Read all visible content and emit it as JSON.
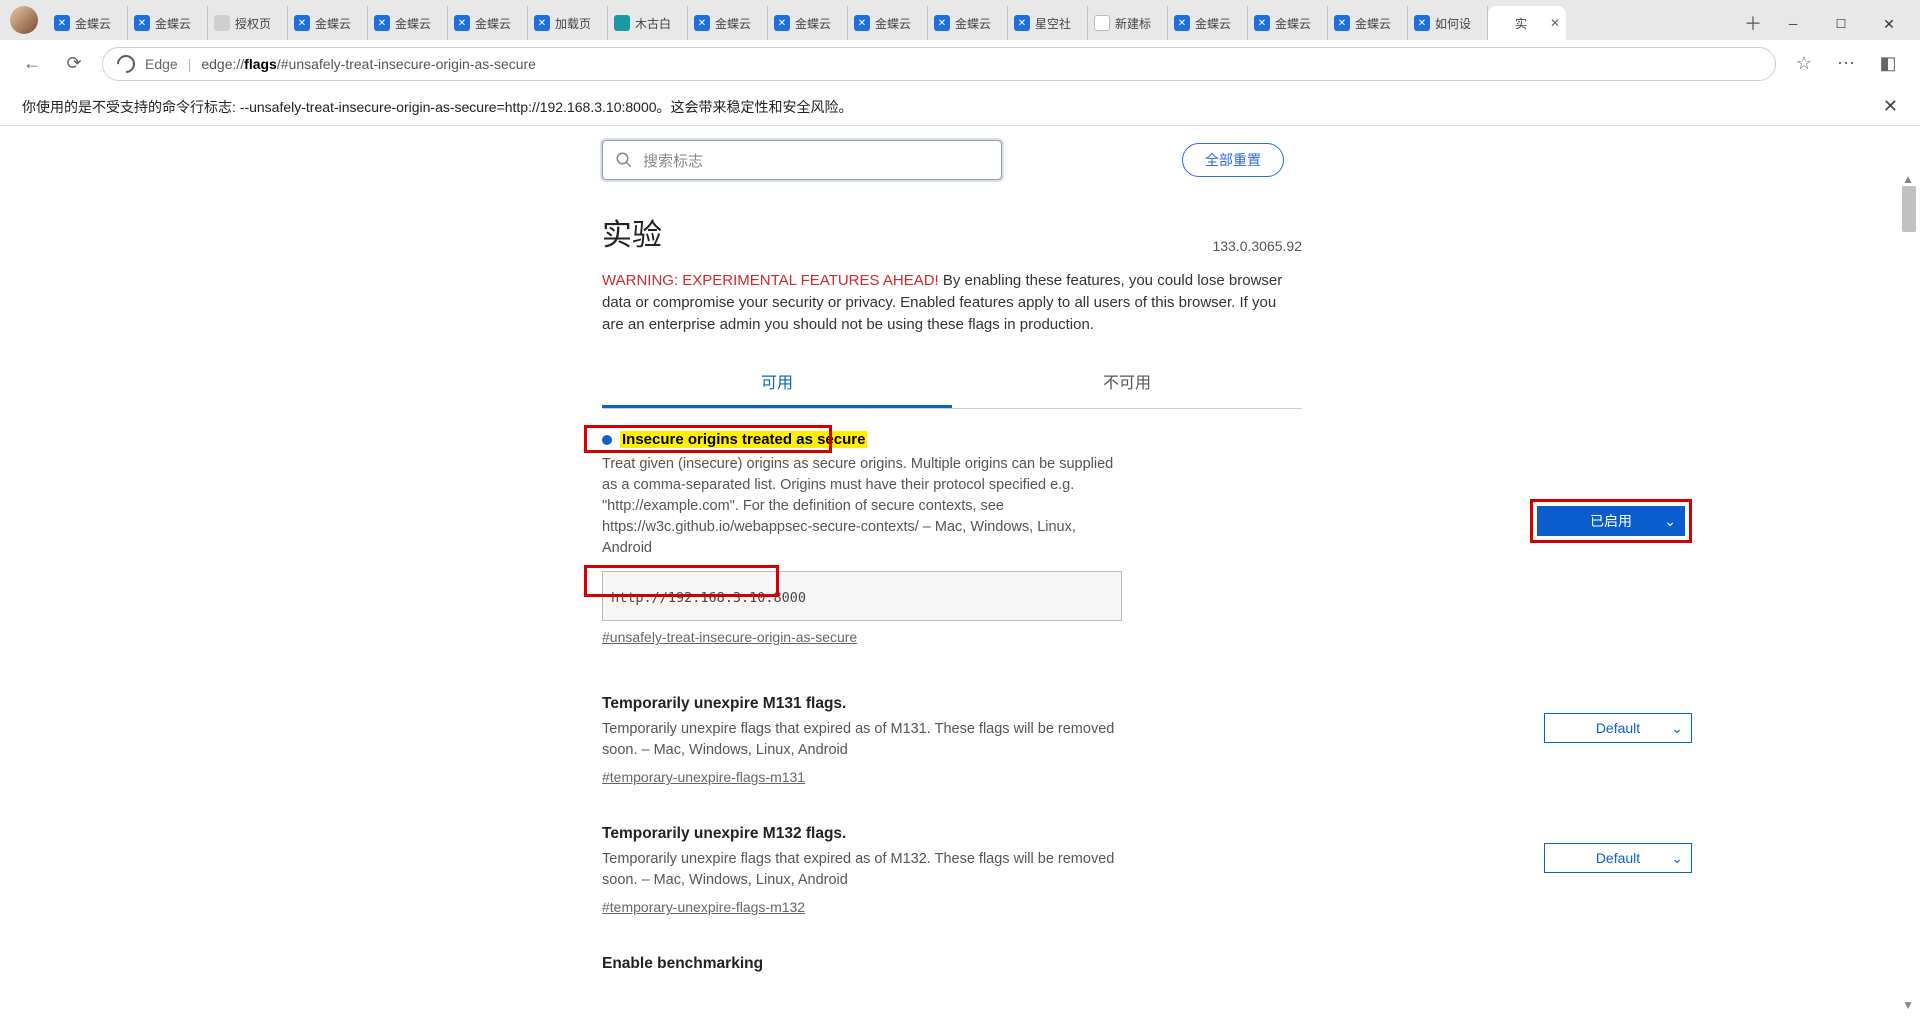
{
  "tabs": [
    {
      "t": "金蝶云",
      "f": "blue"
    },
    {
      "t": "金蝶云",
      "f": "blue"
    },
    {
      "t": "授权页",
      "f": "gray"
    },
    {
      "t": "金蝶云",
      "f": "blue"
    },
    {
      "t": "金蝶云",
      "f": "blue"
    },
    {
      "t": "金蝶云",
      "f": "blue"
    },
    {
      "t": "加载页",
      "f": "blue"
    },
    {
      "t": "木古白",
      "f": "teal"
    },
    {
      "t": "金蝶云",
      "f": "blue"
    },
    {
      "t": "金蝶云",
      "f": "blue"
    },
    {
      "t": "金蝶云",
      "f": "blue"
    },
    {
      "t": "金蝶云",
      "f": "blue"
    },
    {
      "t": "星空社",
      "f": "blue"
    },
    {
      "t": "新建标",
      "f": "doc"
    },
    {
      "t": "金蝶云",
      "f": "blue"
    },
    {
      "t": "金蝶云",
      "f": "blue"
    },
    {
      "t": "金蝶云",
      "f": "blue"
    },
    {
      "t": "如何设",
      "f": "blue"
    }
  ],
  "active_tab": {
    "t": "实"
  },
  "address": {
    "label": "Edge",
    "url_prefix": "edge://",
    "url_bold": "flags",
    "url_suffix": "/#unsafely-treat-insecure-origin-as-secure"
  },
  "warning_strip": "你使用的是不受支持的命令行标志: --unsafely-treat-insecure-origin-as-secure=http://192.168.3.10:8000。这会带来稳定性和安全风险。",
  "search_placeholder": "搜索标志",
  "reset_all": "全部重置",
  "page_title": "实验",
  "version": "133.0.3065.92",
  "warning_head": "WARNING: EXPERIMENTAL FEATURES AHEAD!",
  "warning_body": " By enabling these features, you could lose browser data or compromise your security or privacy. Enabled features apply to all users of this browser. If you are an enterprise admin you should not be using these flags in production.",
  "tab_available": "可用",
  "tab_unavailable": "不可用",
  "flag1": {
    "title": "Insecure origins treated as secure",
    "desc": "Treat given (insecure) origins as secure origins. Multiple origins can be supplied as a comma-separated list. Origins must have their protocol specified e.g. \"http://example.com\". For the definition of secure contexts, see https://w3c.github.io/webappsec-secure-contexts/ – Mac, Windows, Linux, Android",
    "input": "http://192.168.3.10:8000",
    "hash": "#unsafely-treat-insecure-origin-as-secure",
    "select": "已启用"
  },
  "flag2": {
    "title": "Temporarily unexpire M131 flags.",
    "desc": "Temporarily unexpire flags that expired as of M131. These flags will be removed soon. – Mac, Windows, Linux, Android",
    "hash": "#temporary-unexpire-flags-m131",
    "select": "Default"
  },
  "flag3": {
    "title": "Temporarily unexpire M132 flags.",
    "desc": "Temporarily unexpire flags that expired as of M132. These flags will be removed soon. – Mac, Windows, Linux, Android",
    "hash": "#temporary-unexpire-flags-m132",
    "select": "Default"
  },
  "flag4": {
    "title": "Enable benchmarking"
  }
}
